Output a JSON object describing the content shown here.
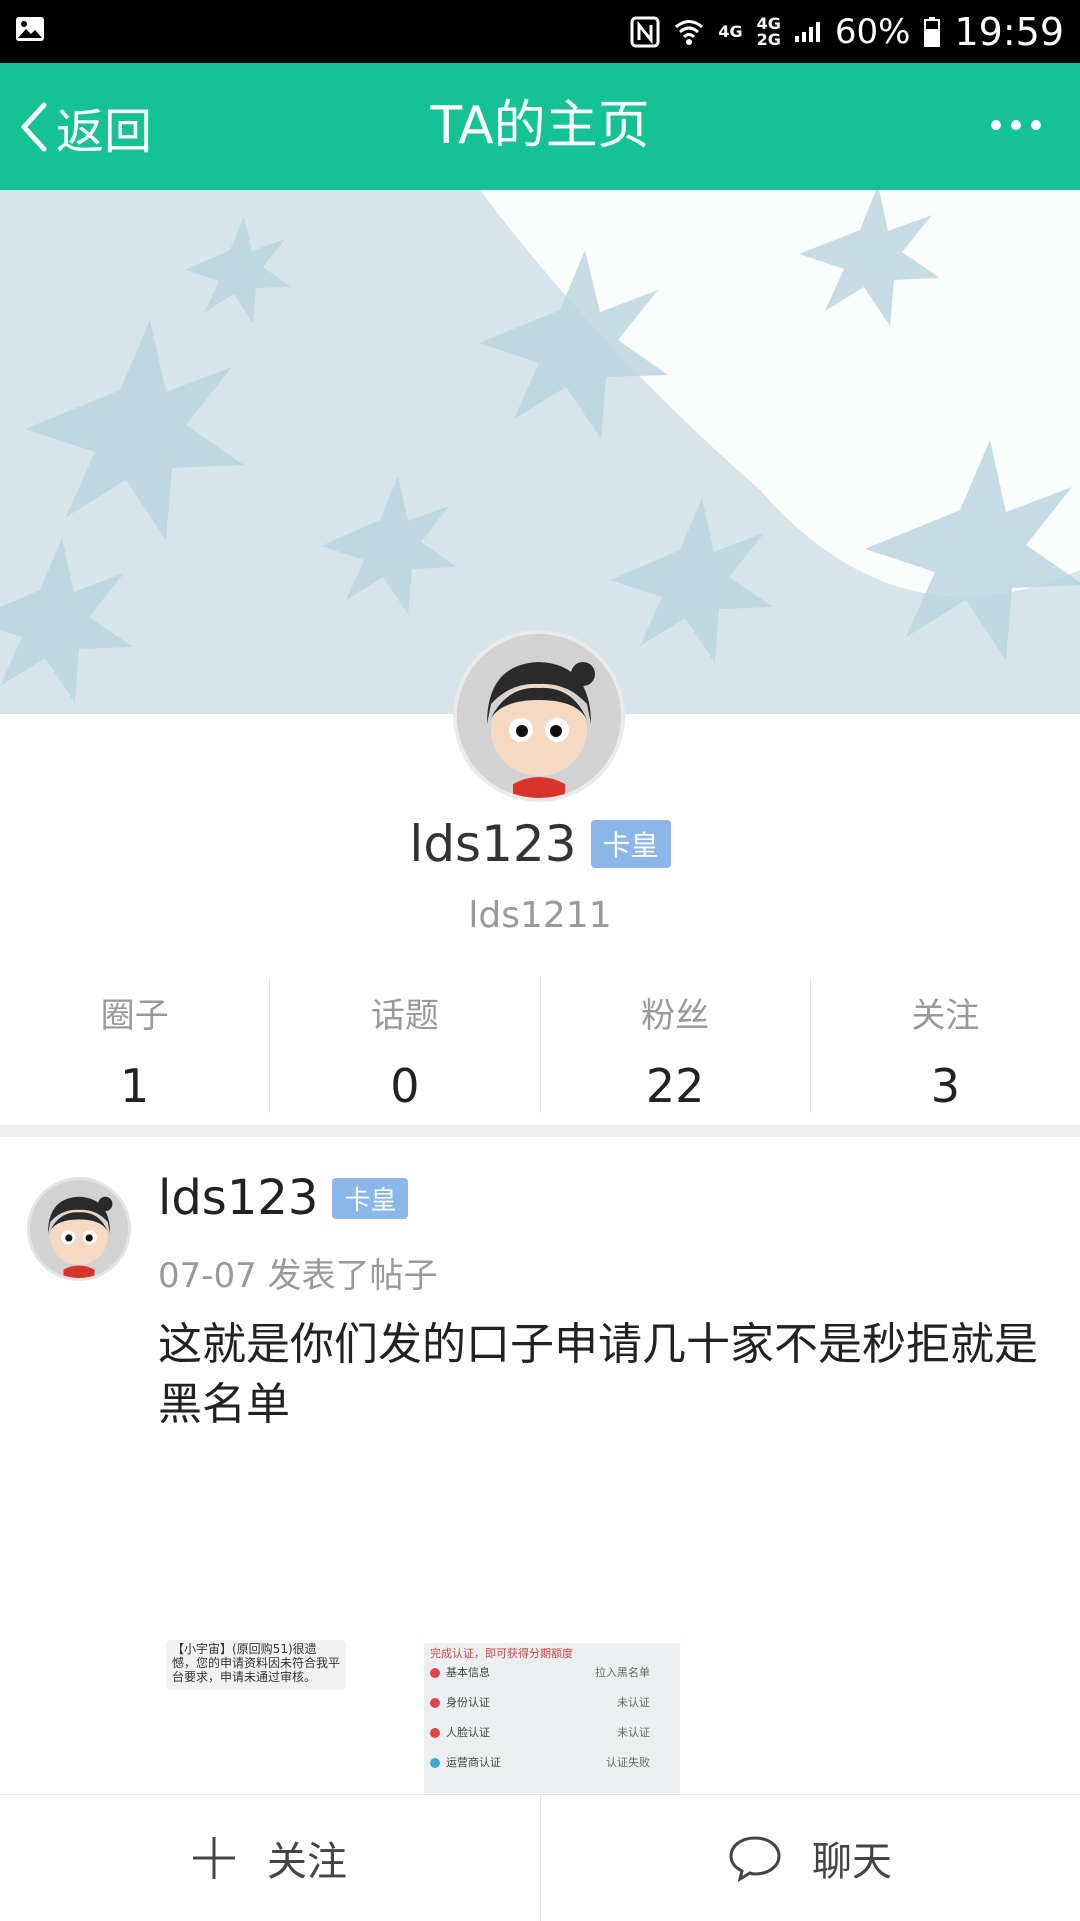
{
  "status_bar": {
    "net_top": "4G",
    "net_bottom_a": "4G",
    "net_bottom_b": "2G",
    "battery": "60%",
    "time": "19:59"
  },
  "header": {
    "back_label": "返回",
    "title": "TA的主页"
  },
  "profile": {
    "name": "lds123",
    "badge": "卡皇",
    "user_id": "lds1211"
  },
  "stats": [
    {
      "label": "圈子",
      "value": "1"
    },
    {
      "label": "话题",
      "value": "0"
    },
    {
      "label": "粉丝",
      "value": "22"
    },
    {
      "label": "关注",
      "value": "3"
    }
  ],
  "post": {
    "author": "lds123",
    "badge": "卡皇",
    "meta": "07-07 发表了帖子",
    "text": "这就是你们发的口子申请几十家不是秒拒就是黑名单",
    "image1_text": "【小宇宙】(原回购51)很遗憾，您的申请资料因未符合我平台要求，申请未通过审核。",
    "image2": {
      "top": "完成认证，即可获得分期额度",
      "rows": [
        {
          "label": "基本信息",
          "status": "拉入黑名单"
        },
        {
          "label": "身份认证",
          "status": "未认证"
        },
        {
          "label": "人脸认证",
          "status": "未认证"
        },
        {
          "label": "运营商认证",
          "status": "认证失败"
        }
      ]
    }
  },
  "bottom_bar": {
    "follow_label": "关注",
    "chat_label": "聊天"
  },
  "colors": {
    "header_bg": "#14c295",
    "badge_bg": "#8ab7e8",
    "banner_bg": "#d6e5ea"
  }
}
